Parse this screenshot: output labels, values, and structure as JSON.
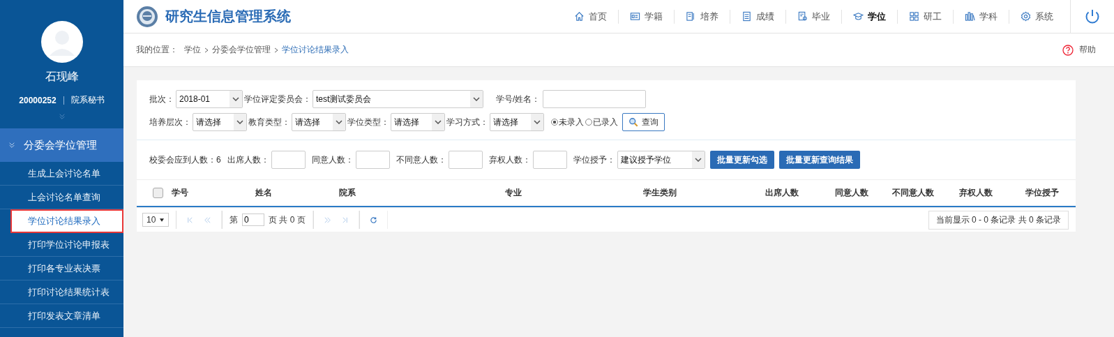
{
  "user": {
    "name": "石现峰",
    "id": "20000252",
    "role": "院系秘书"
  },
  "sidebar": {
    "group": {
      "label": "分委会学位管理",
      "expanded": true
    },
    "items": [
      {
        "label": "生成上会讨论名单",
        "selected": false
      },
      {
        "label": "上会讨论名单查询",
        "selected": false
      },
      {
        "label": "学位讨论结果录入",
        "selected": true
      },
      {
        "label": "打印学位讨论申报表",
        "selected": false
      },
      {
        "label": "打印各专业表决票",
        "selected": false
      },
      {
        "label": "打印讨论结果统计表",
        "selected": false
      },
      {
        "label": "打印发表文章清单",
        "selected": false
      }
    ]
  },
  "header": {
    "title": "研究生信息管理系统",
    "nav": [
      {
        "label": "首页",
        "selected": false
      },
      {
        "label": "学籍",
        "selected": false
      },
      {
        "label": "培养",
        "selected": false
      },
      {
        "label": "成绩",
        "selected": false
      },
      {
        "label": "毕业",
        "selected": false
      },
      {
        "label": "学位",
        "selected": true
      },
      {
        "label": "研工",
        "selected": false
      },
      {
        "label": "学科",
        "selected": false
      },
      {
        "label": "系统",
        "selected": false
      }
    ]
  },
  "breadcrumb": {
    "prefix": "我的位置：",
    "items": [
      {
        "label": "学位"
      },
      {
        "label": "分委会学位管理"
      },
      {
        "label": "学位讨论结果录入"
      }
    ],
    "help": "帮助"
  },
  "filters": {
    "batch": {
      "label": "批次：",
      "value": "2018-01"
    },
    "committee": {
      "label": "学位评定委员会：",
      "value": "test测试委员会"
    },
    "student": {
      "label": "学号/姓名："
    },
    "selects": [
      {
        "label": "培养层次：",
        "value": "请选择"
      },
      {
        "label": "教育类型：",
        "value": "请选择"
      },
      {
        "label": "学位类型：",
        "value": "请选择"
      },
      {
        "label": "学习方式：",
        "value": "请选择"
      }
    ],
    "radios": [
      {
        "label": "未录入",
        "selected": true
      },
      {
        "label": "已录入",
        "selected": false
      }
    ],
    "search": "查询"
  },
  "batch_bar": {
    "expected": "校委会应到人数：6",
    "fields": [
      {
        "label": "出席人数："
      },
      {
        "label": "同意人数："
      },
      {
        "label": "不同意人数："
      },
      {
        "label": "弃权人数："
      }
    ],
    "degree": {
      "label": "学位授予：",
      "value": "建议授予学位"
    },
    "buttons": [
      "批量更新勾选",
      "批量更新查询结果"
    ]
  },
  "table": {
    "select_all": false,
    "columns": [
      "学号",
      "姓名",
      "院系",
      "专业",
      "学生类别",
      "出席人数",
      "同意人数",
      "不同意人数",
      "弃权人数",
      "学位授予"
    ]
  },
  "pager": {
    "size": "10",
    "page_prefix": "第",
    "page": "0",
    "page_suffix": "页 共 0 页",
    "info": "当前显示 0 - 0 条记录 共 0 条记录"
  }
}
